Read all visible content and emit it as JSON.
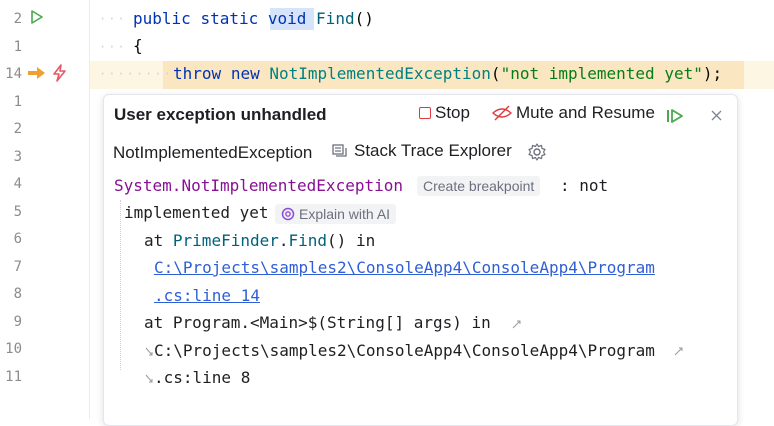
{
  "gutter": {
    "line_numbers": [
      "2",
      "1",
      "14",
      "1",
      "2",
      "3",
      "4",
      "5",
      "6",
      "7",
      "8",
      "9",
      "10",
      "11"
    ]
  },
  "code": {
    "line1_kw1": "public",
    "line1_kw2": "static",
    "line1_kw3": "void",
    "line1_fn": "Find",
    "line1_rest": "()",
    "line2": "{",
    "line3_kw1": "throw",
    "line3_kw2": "new",
    "line3_cls": "NotImplementedException",
    "line3_open": "(",
    "line3_str": "\"not implemented yet\"",
    "line3_close": ");"
  },
  "popup": {
    "title": "User exception unhandled",
    "stop_label": "Stop",
    "mute_label": "Mute and Resume",
    "exception_type": "NotImplementedException",
    "stack_trace_label": "Stack Trace Explorer",
    "trace": {
      "ns": "System.",
      "exc": "NotImplementedException",
      "create_breakpoint": "Create breakpoint",
      "colon_msg": ": not",
      "msg_cont": "implemented yet",
      "explain_ai": "Explain with AI",
      "at1": "at ",
      "frame1_cls": "PrimeFinder",
      "frame1_dot": ".",
      "frame1_fn": "Find",
      "frame1_rest": "() in",
      "path1a": "C:\\Projects\\samples2\\ConsoleApp4\\ConsoleApp4\\Program",
      "path1b": ".cs:line 14",
      "at2": "at Program.<Main>$(String[] args) in",
      "path2a": "C:\\Projects\\samples2\\ConsoleApp4\\ConsoleApp4\\Program",
      "path2b": ".cs:line 8"
    }
  },
  "colors": {
    "keyword": "#0033b3",
    "function": "#00627a",
    "class": "#008080",
    "string": "#067d17",
    "exception_type": "#871094",
    "link": "#2f5fd6",
    "exec_highlight": "#fbe6c2",
    "stop_red": "#e0393e",
    "resume_green": "#4aa84f",
    "bolt_red": "#e55765",
    "arrow_orange": "#f0a030"
  },
  "icons": [
    "run-gutter-icon",
    "execution-point-arrow-icon",
    "exception-bolt-icon",
    "stop-icon",
    "mute-icon",
    "resume-icon",
    "close-icon",
    "stack-trace-icon",
    "settings-gear-icon",
    "ai-sparkle-icon",
    "soft-wrap-icon"
  ]
}
